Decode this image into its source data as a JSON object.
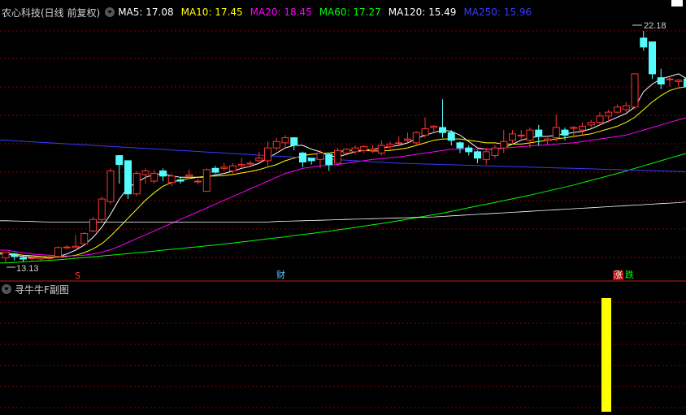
{
  "header": {
    "title": "农心科技(日线 前复权)",
    "ma": [
      {
        "label": "MA5: 17.08",
        "color": "#ffffff"
      },
      {
        "label": "MA10: 17.45",
        "color": "#ffff00"
      },
      {
        "label": "MA20: 18.45",
        "color": "#ff00ff"
      },
      {
        "label": "MA60: 17.27",
        "color": "#00ff00"
      },
      {
        "label": "MA120: 15.49",
        "color": "#ffffff"
      },
      {
        "label": "MA250: 15.96",
        "color": "#3a3aff"
      }
    ]
  },
  "price": {
    "high_label": "22.18",
    "low_label": "13.13"
  },
  "markers": {
    "s": "S",
    "cai": "财",
    "zhang": "涨",
    "die": "跌"
  },
  "subchart": {
    "title": "寻牛牛F副图",
    "bar_color": "#ffff00"
  },
  "colors": {
    "up": "#ff3232",
    "down": "#54fcfc",
    "grid": "#8b0000",
    "divider": "#b22222"
  },
  "candles": [
    [
      13.3,
      13.5,
      13.1,
      13.5
    ],
    [
      13.45,
      13.35,
      13.2,
      13.5
    ],
    [
      13.3,
      13.25,
      13.15,
      13.4
    ],
    [
      13.3,
      13.3,
      13.2,
      13.35
    ],
    [
      13.25,
      13.3,
      13.2,
      13.35
    ],
    [
      13.3,
      13.3,
      13.2,
      13.4
    ],
    [
      13.35,
      13.7,
      13.3,
      13.75
    ],
    [
      13.7,
      13.72,
      13.65,
      13.8
    ],
    [
      13.7,
      13.75,
      13.7,
      14.2
    ],
    [
      13.85,
      14.25,
      13.8,
      14.3
    ],
    [
      14.35,
      14.8,
      14.3,
      14.9
    ],
    [
      14.8,
      15.6,
      14.7,
      15.7
    ],
    [
      15.5,
      16.7,
      15.4,
      16.8
    ],
    [
      17.3,
      16.95,
      16.2,
      17.3
    ],
    [
      17.1,
      15.8,
      15.6,
      17.1
    ],
    [
      15.8,
      16.6,
      15.7,
      16.7
    ],
    [
      16.55,
      16.7,
      16.2,
      16.8
    ],
    [
      16.3,
      16.6,
      16.2,
      16.75
    ],
    [
      16.7,
      16.5,
      16.3,
      16.8
    ],
    [
      16.25,
      16.5,
      16.1,
      16.6
    ],
    [
      16.35,
      16.3,
      16.2,
      16.45
    ],
    [
      16.5,
      16.55,
      16.4,
      16.75
    ],
    [
      16.3,
      16.3,
      16.2,
      16.4
    ],
    [
      15.9,
      16.75,
      15.9,
      16.8
    ],
    [
      16.8,
      16.65,
      16.6,
      16.9
    ],
    [
      16.8,
      16.85,
      16.7,
      17.0
    ],
    [
      16.7,
      16.9,
      16.6,
      17.0
    ],
    [
      16.9,
      16.95,
      16.8,
      17.2
    ],
    [
      17.0,
      17.0,
      16.85,
      17.1
    ],
    [
      17.1,
      17.2,
      17.0,
      17.45
    ],
    [
      17.1,
      17.6,
      16.85,
      17.85
    ],
    [
      17.6,
      17.85,
      17.5,
      18.0
    ],
    [
      17.8,
      18.0,
      17.6,
      18.1
    ],
    [
      18.0,
      17.7,
      17.5,
      18.0
    ],
    [
      17.4,
      17.05,
      16.85,
      17.45
    ],
    [
      17.2,
      17.1,
      16.95,
      17.2
    ],
    [
      17.15,
      17.4,
      16.8,
      17.5
    ],
    [
      17.35,
      16.95,
      16.7,
      17.4
    ],
    [
      17.0,
      17.5,
      16.9,
      17.6
    ],
    [
      17.4,
      17.55,
      17.3,
      17.6
    ],
    [
      17.45,
      17.6,
      17.35,
      17.7
    ],
    [
      17.5,
      17.65,
      17.4,
      17.7
    ],
    [
      17.5,
      17.55,
      17.4,
      17.7
    ],
    [
      17.4,
      17.7,
      17.3,
      17.9
    ],
    [
      17.65,
      17.75,
      17.5,
      17.85
    ],
    [
      17.8,
      17.8,
      17.7,
      18.05
    ],
    [
      17.9,
      17.95,
      17.8,
      18.2
    ],
    [
      17.8,
      18.2,
      17.7,
      18.25
    ],
    [
      18.1,
      18.35,
      18.0,
      18.8
    ],
    [
      18.4,
      18.45,
      18.2,
      18.5
    ],
    [
      18.4,
      18.2,
      18.0,
      19.5
    ],
    [
      18.2,
      17.9,
      17.7,
      18.3
    ],
    [
      17.8,
      17.6,
      17.4,
      17.85
    ],
    [
      17.6,
      17.45,
      17.3,
      17.7
    ],
    [
      17.45,
      17.2,
      17.0,
      17.5
    ],
    [
      17.15,
      17.45,
      16.95,
      17.6
    ],
    [
      17.3,
      17.6,
      17.2,
      17.7
    ],
    [
      17.6,
      17.85,
      17.4,
      18.3
    ],
    [
      17.9,
      18.15,
      17.8,
      18.3
    ],
    [
      18.1,
      18.1,
      17.9,
      18.3
    ],
    [
      17.9,
      18.3,
      17.6,
      18.4
    ],
    [
      18.3,
      18.05,
      17.7,
      18.5
    ],
    [
      17.9,
      17.95,
      17.7,
      18.0
    ],
    [
      18.0,
      18.4,
      17.85,
      18.9
    ],
    [
      18.3,
      18.1,
      17.9,
      18.4
    ],
    [
      18.4,
      18.4,
      18.0,
      18.45
    ],
    [
      18.3,
      18.45,
      18.1,
      18.6
    ],
    [
      18.5,
      18.6,
      18.4,
      18.7
    ],
    [
      18.6,
      18.85,
      18.5,
      19.0
    ],
    [
      18.85,
      19.0,
      18.6,
      19.1
    ],
    [
      19.0,
      19.2,
      18.95,
      19.3
    ],
    [
      19.1,
      19.25,
      19.0,
      19.4
    ],
    [
      19.2,
      20.5,
      19.1,
      20.5
    ],
    [
      21.9,
      21.55,
      21.4,
      22.18
    ],
    [
      21.75,
      20.5,
      20.3,
      21.75
    ],
    [
      20.35,
      20.1,
      19.9,
      20.7
    ],
    [
      20.3,
      20.3,
      20.0,
      20.4
    ],
    [
      20.2,
      20.25,
      20.0,
      20.3
    ],
    [
      20.3,
      20.0,
      19.9,
      20.3
    ]
  ],
  "ma_series": {
    "ma5": [
      13.45,
      13.4,
      13.35,
      13.32,
      13.3,
      13.3,
      13.35,
      13.45,
      13.6,
      13.8,
      14.1,
      14.5,
      15.0,
      15.6,
      16.05,
      16.25,
      16.45,
      16.55,
      16.6,
      16.5,
      16.45,
      16.45,
      16.45,
      16.45,
      16.55,
      16.6,
      16.7,
      16.8,
      16.88,
      17.0,
      17.2,
      17.4,
      17.6,
      17.7,
      17.7,
      17.55,
      17.45,
      17.3,
      17.25,
      17.35,
      17.45,
      17.5,
      17.55,
      17.6,
      17.65,
      17.7,
      17.8,
      17.95,
      18.1,
      18.2,
      18.3,
      18.25,
      18.1,
      17.85,
      17.6,
      17.55,
      17.55,
      17.6,
      17.75,
      17.9,
      18.0,
      18.05,
      18.05,
      18.1,
      18.15,
      18.2,
      18.25,
      18.35,
      18.5,
      18.65,
      18.8,
      18.95,
      19.2,
      19.8,
      20.1,
      20.3,
      20.4,
      20.5,
      20.3
    ],
    "ma10": [
      13.5,
      13.45,
      13.4,
      13.38,
      13.35,
      13.33,
      13.33,
      13.35,
      13.4,
      13.5,
      13.65,
      13.85,
      14.15,
      14.5,
      14.85,
      15.2,
      15.55,
      15.85,
      16.1,
      16.25,
      16.35,
      16.4,
      16.45,
      16.5,
      16.5,
      16.52,
      16.56,
      16.62,
      16.68,
      16.75,
      16.85,
      16.95,
      17.1,
      17.2,
      17.3,
      17.35,
      17.38,
      17.4,
      17.45,
      17.5,
      17.5,
      17.5,
      17.48,
      17.48,
      17.5,
      17.55,
      17.6,
      17.7,
      17.8,
      17.9,
      17.95,
      17.95,
      17.95,
      17.9,
      17.85,
      17.8,
      17.8,
      17.75,
      17.75,
      17.75,
      17.8,
      17.85,
      17.9,
      17.95,
      18.0,
      18.05,
      18.1,
      18.15,
      18.25,
      18.35,
      18.45,
      18.6,
      18.8,
      19.1,
      19.4,
      19.65,
      19.85,
      19.95,
      20.0
    ],
    "ma20": [
      13.6,
      13.55,
      13.5,
      13.45,
      13.42,
      13.4,
      13.38,
      13.37,
      13.38,
      13.4,
      13.45,
      13.52,
      13.62,
      13.75,
      13.9,
      14.05,
      14.2,
      14.35,
      14.5,
      14.65,
      14.8,
      14.95,
      15.1,
      15.25,
      15.4,
      15.55,
      15.7,
      15.85,
      16.0,
      16.15,
      16.3,
      16.45,
      16.6,
      16.7,
      16.8,
      16.85,
      16.9,
      16.92,
      16.95,
      17.0,
      17.05,
      17.1,
      17.15,
      17.18,
      17.22,
      17.25,
      17.3,
      17.35,
      17.4,
      17.45,
      17.5,
      17.55,
      17.55,
      17.55,
      17.55,
      17.55,
      17.57,
      17.6,
      17.62,
      17.65,
      17.68,
      17.7,
      17.72,
      17.75,
      17.78,
      17.8,
      17.85,
      17.9,
      17.95,
      18.0,
      18.05,
      18.1,
      18.2,
      18.3,
      18.4,
      18.5,
      18.6,
      18.7,
      18.8
    ],
    "ma60": [
      13.1,
      13.12,
      13.14,
      13.16,
      13.18,
      13.2,
      13.22,
      13.25,
      13.28,
      13.31,
      13.34,
      13.37,
      13.4,
      13.43,
      13.46,
      13.5,
      13.53,
      13.56,
      13.6,
      13.63,
      13.66,
      13.7,
      13.73,
      13.77,
      13.8,
      13.84,
      13.88,
      13.92,
      13.96,
      14.0,
      14.04,
      14.08,
      14.12,
      14.17,
      14.21,
      14.25,
      14.3,
      14.34,
      14.39,
      14.44,
      14.49,
      14.54,
      14.59,
      14.64,
      14.7,
      14.75,
      14.81,
      14.87,
      14.93,
      14.99,
      15.05,
      15.12,
      15.19,
      15.26,
      15.33,
      15.4,
      15.47,
      15.54,
      15.61,
      15.68,
      15.75,
      15.83,
      15.91,
      15.99,
      16.07,
      16.15,
      16.24,
      16.33,
      16.42,
      16.51,
      16.6,
      16.7,
      16.8,
      16.9,
      17.0,
      17.1,
      17.2,
      17.3,
      17.4
    ],
    "ma120": [
      14.75,
      14.74,
      14.73,
      14.72,
      14.71,
      14.7,
      14.7,
      14.7,
      14.7,
      14.7,
      14.7,
      14.7,
      14.7,
      14.7,
      14.7,
      14.7,
      14.7,
      14.7,
      14.7,
      14.7,
      14.7,
      14.7,
      14.7,
      14.7,
      14.7,
      14.7,
      14.7,
      14.7,
      14.7,
      14.7,
      14.7,
      14.72,
      14.73,
      14.74,
      14.75,
      14.76,
      14.77,
      14.78,
      14.79,
      14.8,
      14.81,
      14.82,
      14.83,
      14.84,
      14.85,
      14.86,
      14.87,
      14.88,
      14.89,
      14.9,
      14.92,
      14.94,
      14.96,
      14.98,
      15.0,
      15.02,
      15.04,
      15.06,
      15.08,
      15.1,
      15.12,
      15.14,
      15.16,
      15.18,
      15.2,
      15.22,
      15.24,
      15.26,
      15.28,
      15.3,
      15.32,
      15.34,
      15.36,
      15.38,
      15.4,
      15.42,
      15.44,
      15.46,
      15.49
    ],
    "ma250": [
      17.9,
      17.88,
      17.86,
      17.84,
      17.82,
      17.8,
      17.78,
      17.76,
      17.74,
      17.72,
      17.7,
      17.68,
      17.66,
      17.64,
      17.62,
      17.6,
      17.58,
      17.56,
      17.54,
      17.52,
      17.5,
      17.48,
      17.46,
      17.44,
      17.42,
      17.4,
      17.38,
      17.36,
      17.34,
      17.32,
      17.3,
      17.28,
      17.26,
      17.24,
      17.22,
      17.2,
      17.18,
      17.16,
      17.14,
      17.12,
      17.1,
      17.08,
      17.06,
      17.04,
      17.02,
      17.0,
      16.99,
      16.98,
      16.97,
      16.96,
      16.95,
      16.94,
      16.93,
      16.92,
      16.91,
      16.9,
      16.89,
      16.88,
      16.87,
      16.86,
      16.85,
      16.84,
      16.83,
      16.82,
      16.81,
      16.8,
      16.79,
      16.78,
      16.77,
      16.76,
      16.75,
      16.74,
      16.73,
      16.72,
      16.71,
      16.7,
      16.69,
      16.68,
      16.67
    ]
  }
}
